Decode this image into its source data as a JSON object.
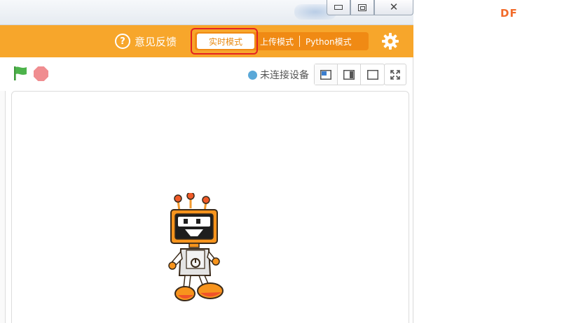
{
  "window": {
    "min_icon": "minimize-icon",
    "max_icon": "maximize-icon",
    "close_icon": "close-icon"
  },
  "menubar": {
    "bg_color": "#f7a62b",
    "feedback_label": "意见反馈",
    "feedback_icon_glyph": "?",
    "modes": [
      {
        "label": "实时模式",
        "active": true
      },
      {
        "label": "上传模式",
        "active": false
      },
      {
        "label": "Python模式",
        "active": false
      }
    ],
    "settings_icon": "gear-icon",
    "highlight_color": "#e32222"
  },
  "stage_toolbar": {
    "run_icon": "green-flag-icon",
    "stop_icon": "stop-icon",
    "device_status": "未连接设备",
    "status_color": "#5aa8d8",
    "layout_icons": [
      "small-stage-layout-icon",
      "normal-stage-layout-icon",
      "large-stage-layout-icon"
    ],
    "fullscreen_icon": "fullscreen-icon"
  },
  "stage": {
    "sprite": "robot-sprite"
  },
  "watermark": "DF"
}
